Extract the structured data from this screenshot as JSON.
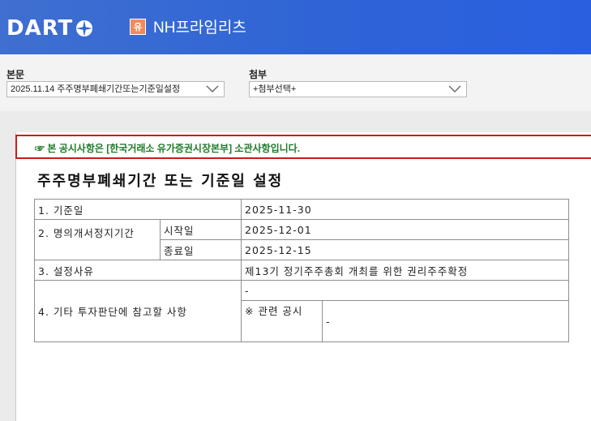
{
  "header": {
    "logo": "DART",
    "badge": "유",
    "company": "NH프라임리츠"
  },
  "selectors": {
    "main_label": "본문",
    "main_value": "2025.11.14  주주명부폐쇄기간또는기준일설정",
    "attach_label": "첨부",
    "attach_value": "+첨부선택+"
  },
  "notice": "☞ 본 공시사항은 [한국거래소 유가증권시장본부] 소관사항입니다.",
  "doc": {
    "title": "주주명부폐쇄기간 또는 기준일 설정",
    "rows": {
      "r1_label": "1. 기준일",
      "r1_value": "2025-11-30",
      "r2_label": "2. 명의개서정지기간",
      "r2_start_label": "시작일",
      "r2_start_value": "2025-12-01",
      "r2_end_label": "종료일",
      "r2_end_value": "2025-12-15",
      "r3_label": "3. 설정사유",
      "r3_value": "제13기 정기주주총회 개최를 위한 권리주주확정",
      "r4_label": "4. 기타 투자판단에 참고할 사항",
      "r4_value": "-",
      "r4_related_label": "※ 관련 공시",
      "r4_related_value": "-"
    }
  },
  "colors": {
    "header_blue": "#2f64d6",
    "notice_border": "#c81e1e",
    "notice_text": "#1f7a2a"
  }
}
